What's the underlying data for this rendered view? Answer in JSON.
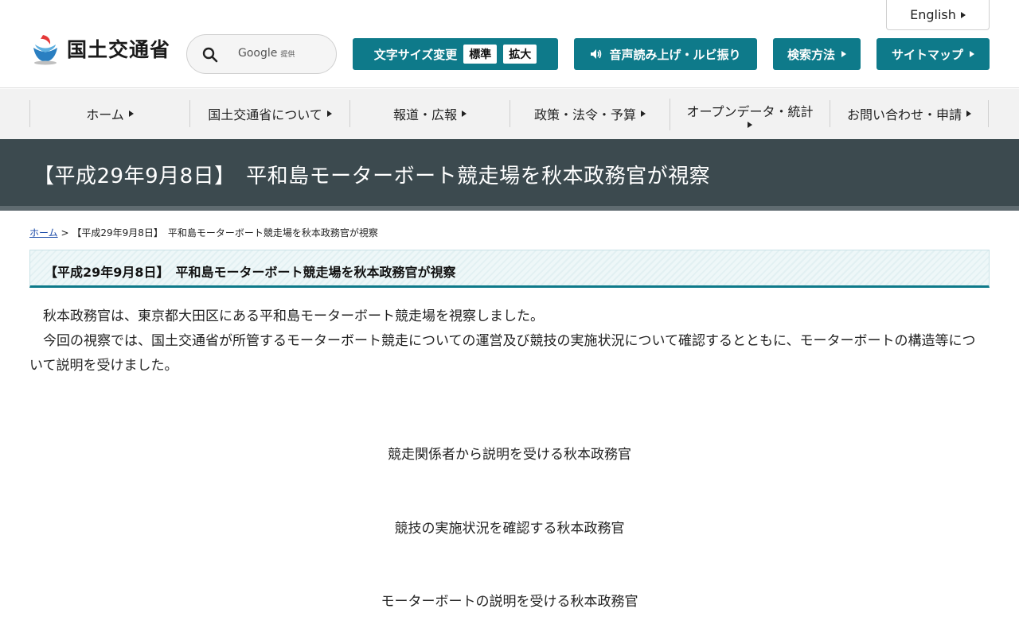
{
  "header": {
    "english_label": "English",
    "logo_text": "国土交通省",
    "search": {
      "provider": "Google",
      "provider_suffix": "提供"
    },
    "font_size": {
      "label": "文字サイズ変更",
      "standard": "標準",
      "large": "拡大"
    },
    "speech_label": "音声読み上げ・ルビ振り",
    "search_method_label": "検索方法",
    "sitemap_label": "サイトマップ"
  },
  "nav": {
    "items": [
      {
        "label": "ホーム"
      },
      {
        "label": "国土交通省について"
      },
      {
        "label": "報道・広報"
      },
      {
        "label": "政策・法令・予算"
      },
      {
        "label": "オープンデータ・統計"
      },
      {
        "label": "お問い合わせ・申請"
      }
    ]
  },
  "page": {
    "title": "【平成29年9月8日】　平和島モーターボート競走場を秋本政務官が視察",
    "breadcrumb": {
      "home": "ホーム",
      "separator": ">",
      "current": "【平成29年9月8日】　平和島モーターボート競走場を秋本政務官が視察"
    },
    "section_title": "【平成29年9月8日】　平和島モーターボート競走場を秋本政務官が視察",
    "paragraphs": [
      "秋本政務官は、東京都大田区にある平和島モーターボート競走場を視察しました。",
      "今回の視察では、国土交通省が所管するモーターボート競走についての運営及び競技の実施状況について確認するとともに、モーターボートの構造等について説明を受けました。"
    ],
    "captions": [
      "競走関係者から説明を受ける秋本政務官",
      "競技の実施状況を確認する秋本政務官",
      "モーターボートの説明を受ける秋本政務官"
    ]
  },
  "colors": {
    "accent": "#0e7a8a",
    "title_band": "#3c4a4f",
    "nav_bg": "#f2f2f2"
  }
}
